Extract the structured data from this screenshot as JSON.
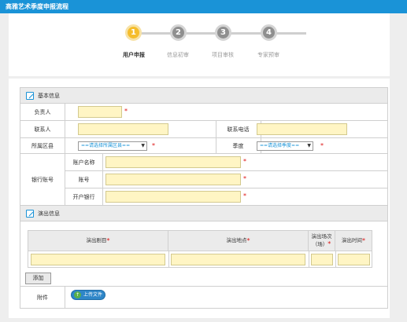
{
  "header": {
    "title": "高雅艺术季度申报流程"
  },
  "steps": [
    {
      "number": "1",
      "label": "用户申报",
      "active": true
    },
    {
      "number": "2",
      "label": "信息初审",
      "active": false
    },
    {
      "number": "3",
      "label": "项目审核",
      "active": false
    },
    {
      "number": "4",
      "label": "专家预审",
      "active": false
    }
  ],
  "basic_info": {
    "heading": "基本信息",
    "responsible_label": "负责人",
    "contact_label": "联系人",
    "phone_label": "联系电话",
    "district_label": "所属区县",
    "district_select": "==请选择所属区县==",
    "quarter_label": "季度",
    "quarter_select": "==请选择季度==",
    "bank_label": "银行账号",
    "account_name_label": "账户名称",
    "account_no_label": "账号",
    "bank_name_label": "开户银行",
    "required_mark": "*",
    "select_arrow": "▼"
  },
  "performance": {
    "heading": "演出信息",
    "col_title": "演出剧目",
    "col_place": "演出地点",
    "col_count_line1": "演出场次",
    "col_count_line2": "（场）",
    "col_time": "演出时间",
    "add_button": "添加"
  },
  "attachment": {
    "label": "附件",
    "upload_button": "上传文件"
  }
}
